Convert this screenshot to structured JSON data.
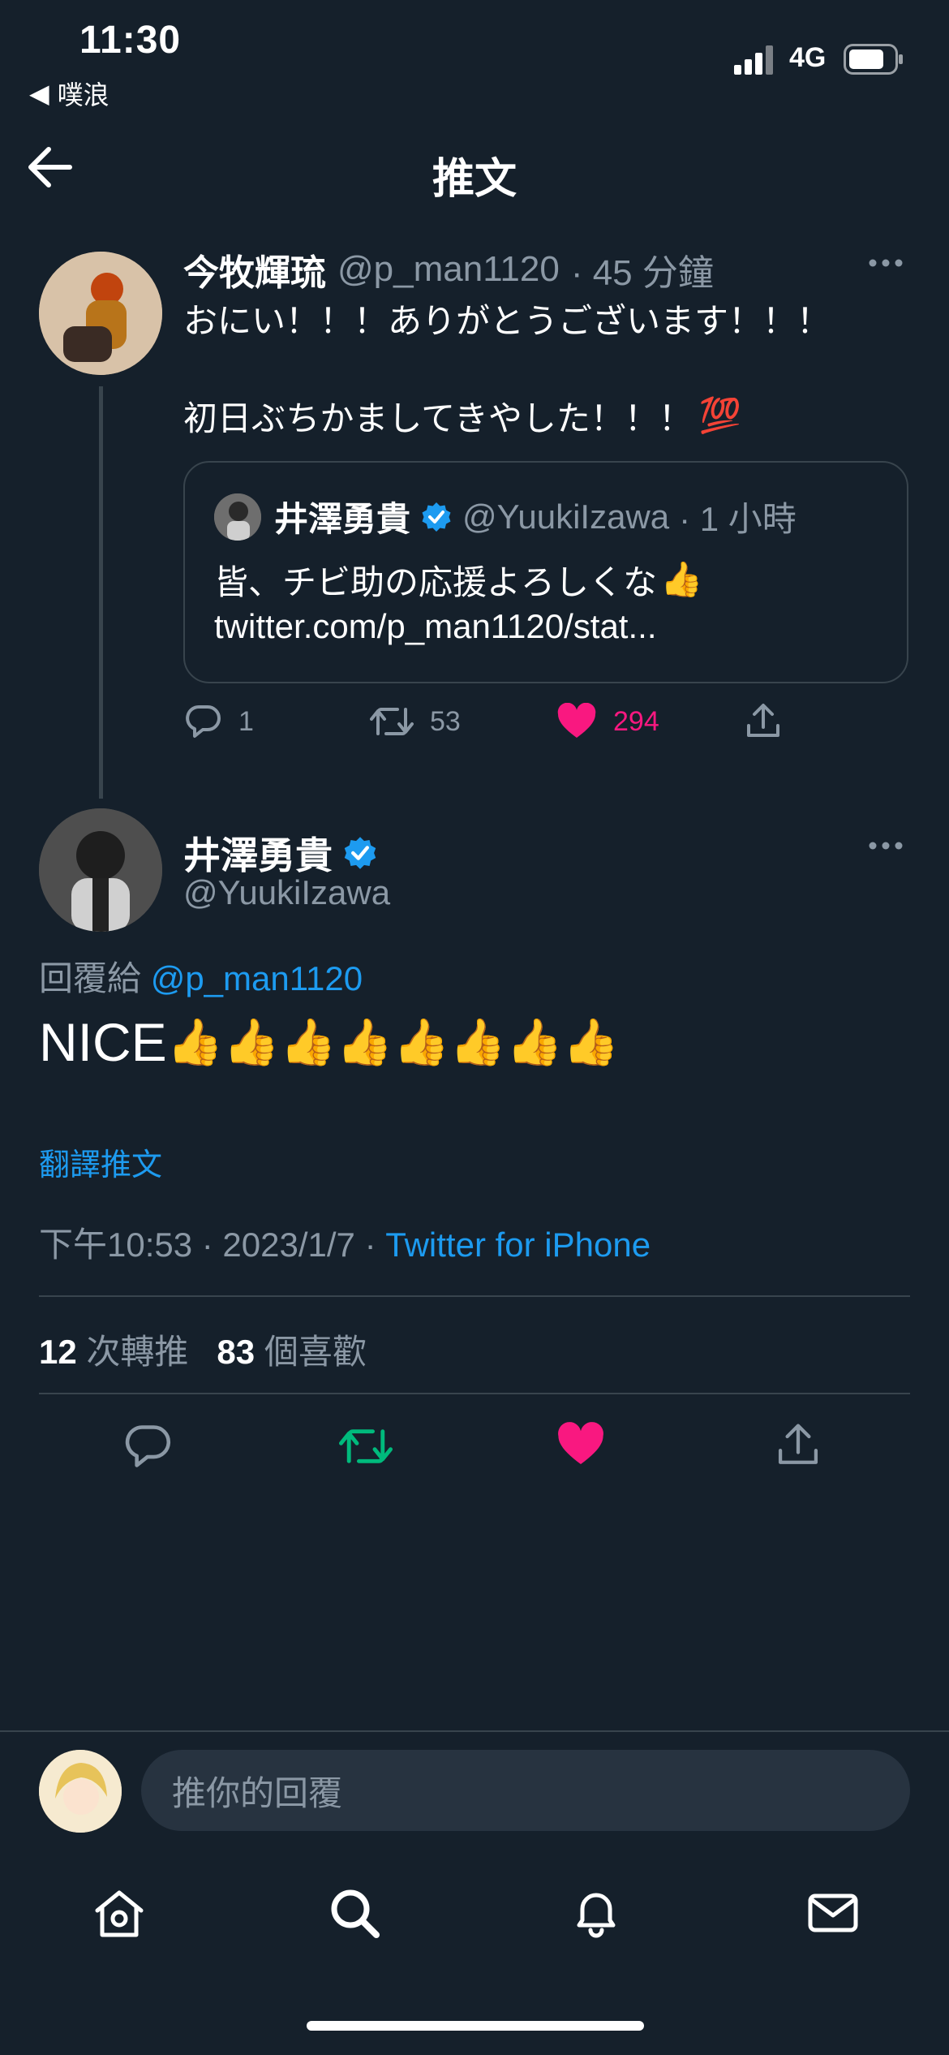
{
  "status_bar": {
    "time": "11:30",
    "back_app": "噗浪",
    "network": "4G"
  },
  "header": {
    "title": "推文"
  },
  "tweet1": {
    "name": "今牧輝琉",
    "handle": "@p_man1120",
    "time": "· 45 分鐘",
    "line1": "おにい！！！ありがとうございます！！！",
    "line2": "初日ぶちかましてきやした！！！",
    "line2_emoji": "💯",
    "quote": {
      "name": "井澤勇貴",
      "handle": "@YuukiIzawa",
      "time": "· 1 小時",
      "line1": "皆、チビ助の応援よろしくな",
      "line1_emoji": "👍",
      "line2": "twitter.com/p_man1120/stat..."
    },
    "actions": {
      "replies": "1",
      "retweets": "53",
      "likes": "294"
    }
  },
  "tweet2": {
    "name": "井澤勇貴",
    "handle": "@YuukiIzawa",
    "reply_prefix": "回覆給",
    "reply_handle": "@p_man1120",
    "text": "NICE",
    "text_emoji": "👍👍👍👍👍👍👍👍",
    "translate": "翻譯推文",
    "time": "下午10:53 · 2023/1/7 · ",
    "source": "Twitter for iPhone",
    "retweets_count": "12",
    "retweets_label": "次轉推",
    "likes_count": "83",
    "likes_label": "個喜歡"
  },
  "reply_bar": {
    "placeholder": "推你的回覆"
  },
  "colors": {
    "background": "#15202b",
    "accent": "#1d9bf0",
    "like": "#f91880",
    "retweet": "#00ba7c",
    "muted": "#8b98a5"
  },
  "icons": [
    "back-arrow-icon",
    "more-icon",
    "reply-icon",
    "retweet-icon",
    "heart-icon",
    "share-icon",
    "verified-icon",
    "home-icon",
    "search-icon",
    "bell-icon",
    "mail-icon"
  ]
}
